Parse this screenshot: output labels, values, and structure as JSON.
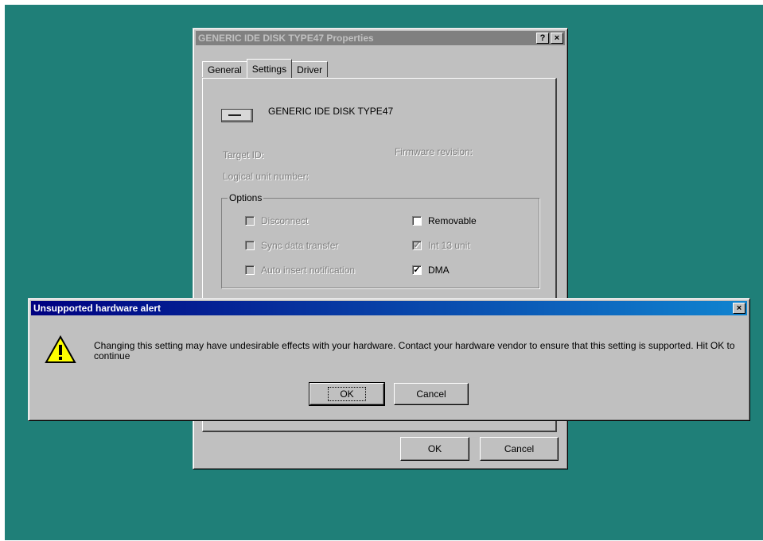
{
  "properties_window": {
    "title": "GENERIC IDE  DISK TYPE47 Properties",
    "help_btn": "?",
    "close_btn": "×",
    "tabs": [
      "General",
      "Settings",
      "Driver"
    ],
    "device_name": "GENERIC IDE  DISK TYPE47",
    "target_id_label": "Target ID:",
    "firmware_label": "Firmware revision:",
    "lun_label": "Logical unit number:",
    "options_label": "Options",
    "checkboxes": [
      {
        "label": "Disconnect",
        "checked": false,
        "enabled": false
      },
      {
        "label": "Sync data transfer",
        "checked": false,
        "enabled": false
      },
      {
        "label": "Auto insert notification",
        "checked": false,
        "enabled": false
      },
      {
        "label": "Removable",
        "checked": false,
        "enabled": true
      },
      {
        "label": "Int 13 unit",
        "checked": true,
        "enabled": false
      },
      {
        "label": "DMA",
        "checked": true,
        "enabled": true
      }
    ],
    "ok_label": "OK",
    "cancel_label": "Cancel"
  },
  "alert": {
    "title": "Unsupported hardware alert",
    "close_btn": "×",
    "icon": "warning-icon",
    "message": "Changing this setting may have undesirable effects with your hardware.   Contact your hardware vendor to ensure that this setting is supported.  Hit OK to continue",
    "ok_label": "OK",
    "cancel_label": "Cancel"
  },
  "colors": {
    "desktop": "#1f7f78",
    "face": "#c0c0c0",
    "active_title": "#000080"
  }
}
